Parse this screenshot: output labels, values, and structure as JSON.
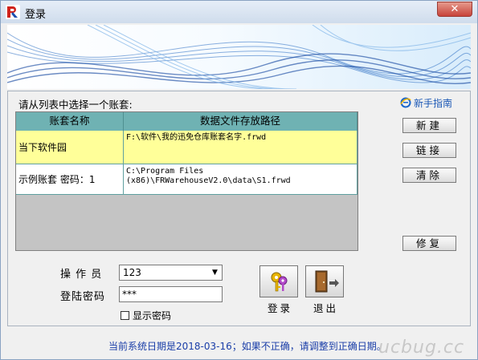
{
  "window": {
    "title": "登录",
    "close_symbol": "✕"
  },
  "prompt": "请从列表中选择一个账套:",
  "guide_link": "新手指南",
  "list": {
    "columns": [
      "账套名称",
      "数据文件存放路径"
    ],
    "rows": [
      {
        "name": "当下软件园",
        "path": "F:\\软件\\我的迅免仓库账套名字.frwd"
      },
      {
        "name": "示例账套 密码：1",
        "path": "C:\\Program Files\n(x86)\\FRWarehouseV2.0\\data\\S1.frwd"
      }
    ]
  },
  "side_buttons": {
    "new": "新建",
    "link": "链接",
    "clear": "清除",
    "repair": "修复"
  },
  "form": {
    "operator_label": "操 作 员",
    "operator_value": "123",
    "password_label": "登陆密码",
    "password_value": "***",
    "show_password_label": "显示密码"
  },
  "actions": {
    "login": "登录",
    "exit": "退出"
  },
  "status": "当前系统日期是2018-03-16；如果不正确，请调整到正确日期。",
  "watermark": "ucbug.cc",
  "colors": {
    "header_bg": "#6fb2b3",
    "row_selected": "#ffff99",
    "row_normal": "#ffffff",
    "status_text": "#1a3ea8"
  }
}
